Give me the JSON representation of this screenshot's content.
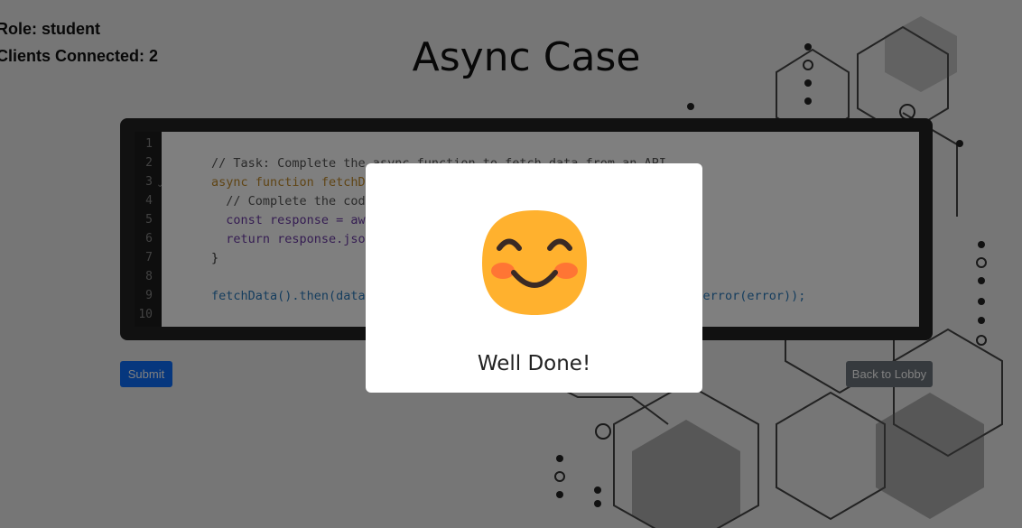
{
  "header": {
    "role_text": "Role: student",
    "clients_text": "Clients Connected: 2",
    "title": "Async Case"
  },
  "editor": {
    "line_numbers": [
      "1",
      "2",
      "3",
      "4",
      "5",
      "6",
      "7",
      "8",
      "9",
      "10"
    ],
    "lines": [
      "",
      "// Task: Complete the async function to fetch data from an API",
      "async function fetchData() {",
      "  // Complete the code",
      "  const response = await fetch(url);",
      "  return response.json();",
      "}",
      "",
      "fetchData().then(data => console.log(data)).catch(error => console.error(error));",
      ""
    ]
  },
  "buttons": {
    "submit_label": "Submit",
    "lobby_label": "Back to Lobby"
  },
  "modal": {
    "message": "Well Done!",
    "icon": "smiling-face-icon"
  },
  "colors": {
    "primary": "#0d6efd",
    "secondary": "#6c757d",
    "editor_bg": "#222222",
    "smiley_face": "#ffb12e",
    "smiley_blush": "#ff6b35"
  }
}
